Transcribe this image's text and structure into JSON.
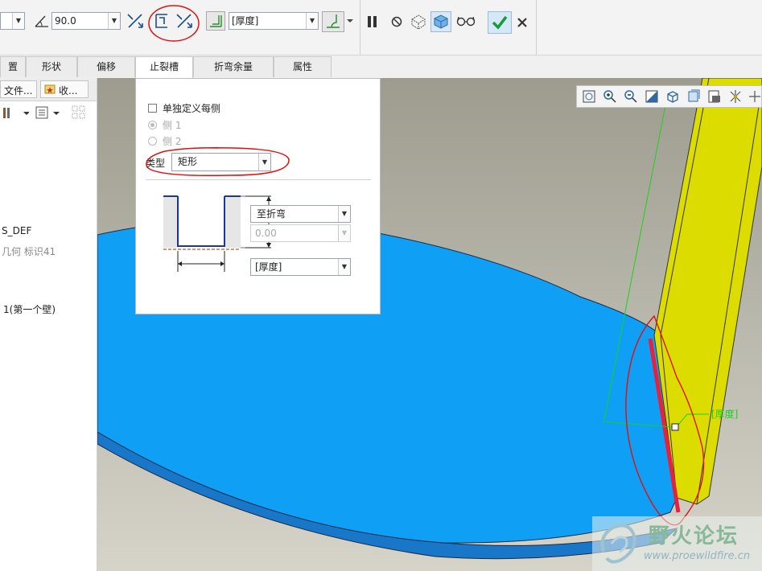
{
  "toolbar": {
    "angle_value": "90.0",
    "thickness_combo": "[厚度]",
    "icons": [
      "angle-icon",
      "flip-side-icon",
      "relief-edge-icon",
      "relief-direction-icon",
      "bend-radius-icon",
      "bend-radius-dim-icon",
      "pause-icon",
      "no-preview-icon",
      "geometry-preview-icon",
      "verify-icon",
      "glasses-icon",
      "confirm-icon",
      "cancel-icon"
    ]
  },
  "tabs": {
    "items": [
      "置",
      "形状",
      "偏移",
      "止裂槽",
      "折弯余量",
      "属性"
    ],
    "active": "止裂槽"
  },
  "tree": {
    "tab_files": "文件...",
    "tab_favorites": "收...",
    "item_def": "S_DEF",
    "item_geom": "几何 标识41",
    "item_wall": "1(第一个壁)"
  },
  "panel": {
    "define_each_side": "单独定义每侧",
    "side1": "侧 1",
    "side2": "侧 2",
    "type_label": "类型",
    "type_value": "矩形",
    "depth_combo": "至折弯",
    "depth_value": "0.00",
    "width_combo": "[厚度]"
  },
  "viewport": {
    "dim_label": "[厚度]",
    "colors": {
      "background_top": "#9d9c8f",
      "background_bottom": "#d6d4c9",
      "base_plate": "#0f9ff5",
      "flange": "#dcdc00",
      "highlight_edge": "#e8203c",
      "annotation_red": "#e01010",
      "dim_green": "#1dd11d"
    }
  },
  "watermark": {
    "title": "野火论坛",
    "url": "www.proewildfire.cn"
  }
}
